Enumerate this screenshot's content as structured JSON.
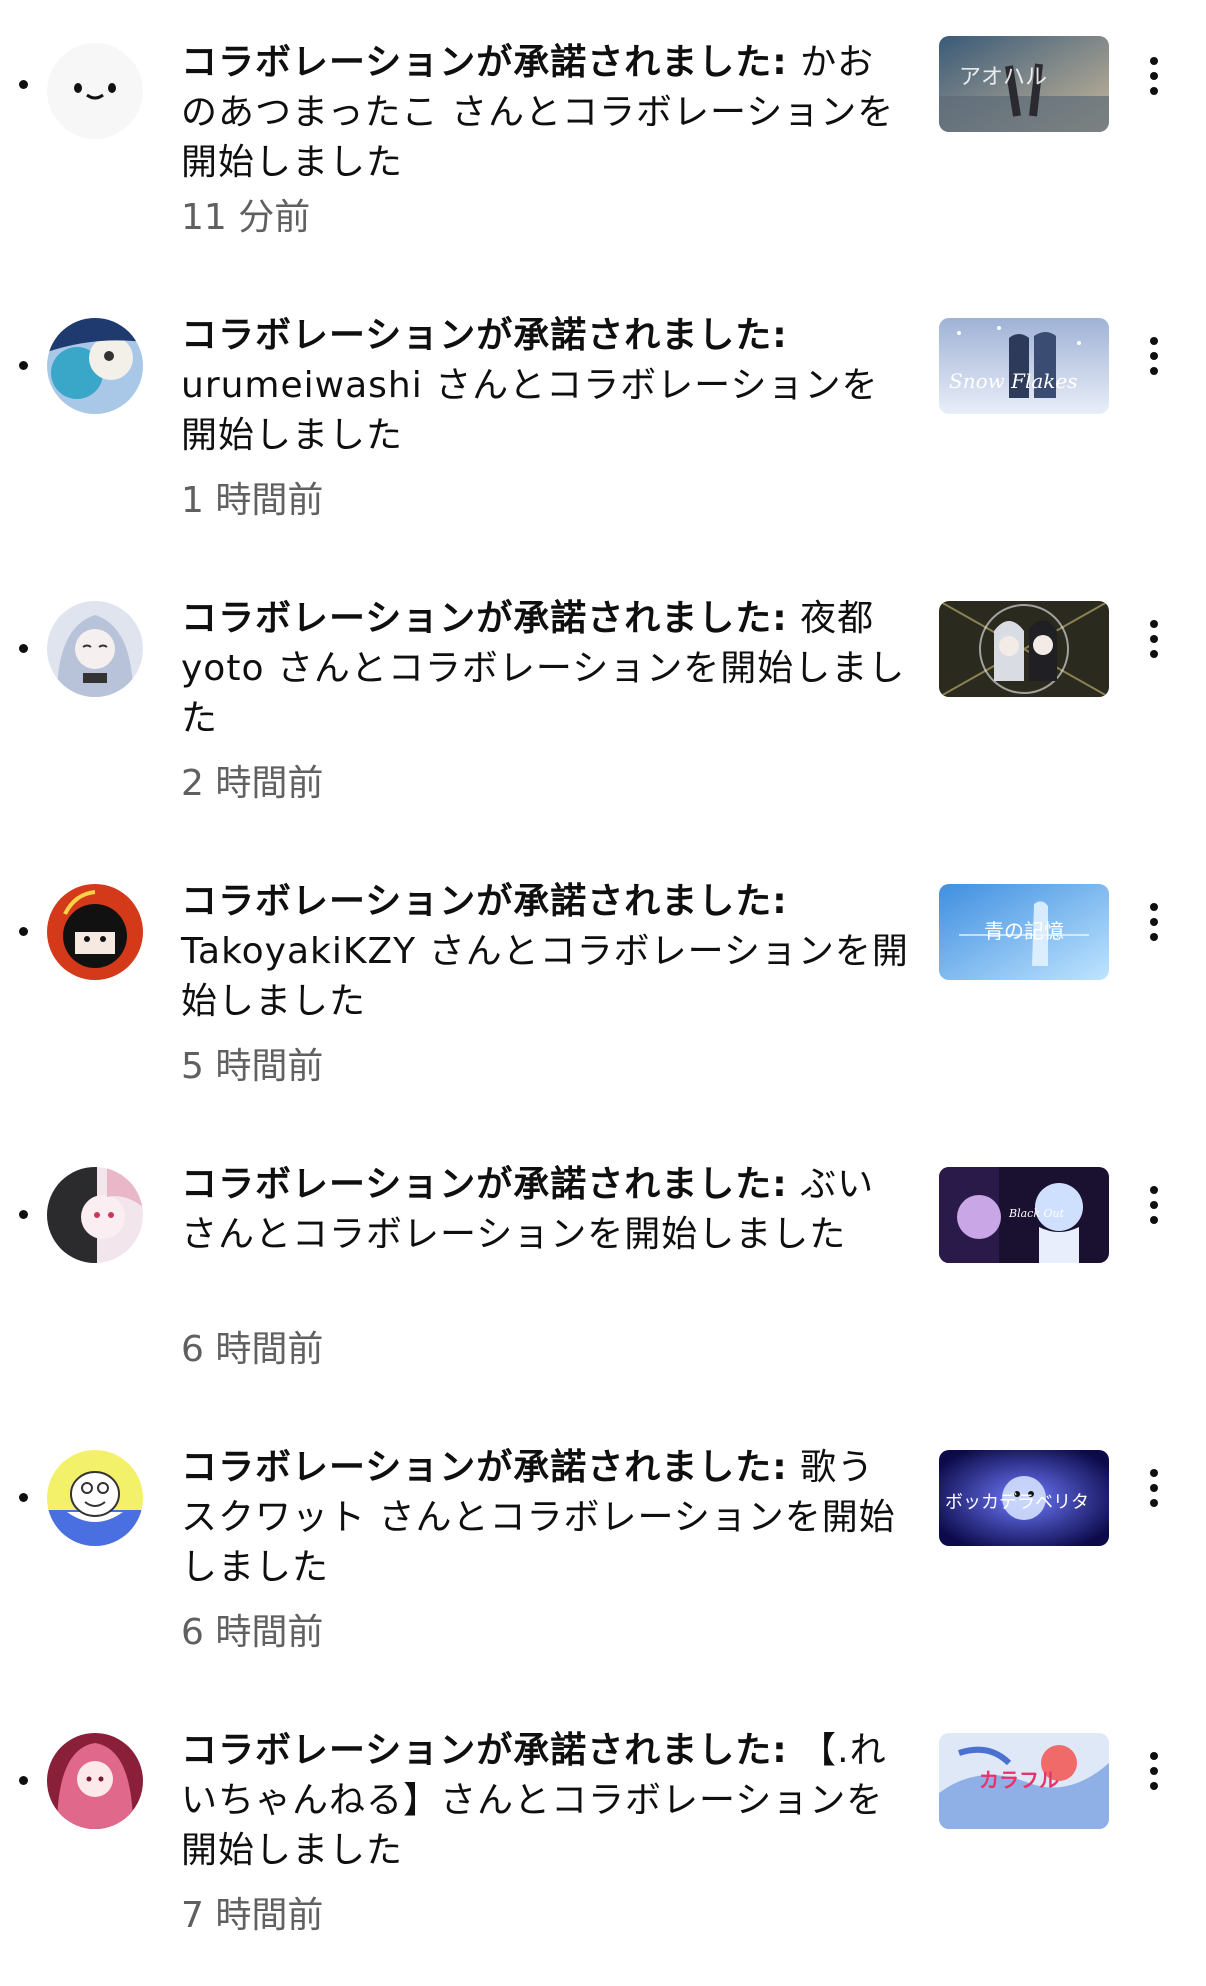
{
  "notifications": [
    {
      "title": "コラボレーションが承諾されました:",
      "message": "かおのあつまったこ さんとコラボレーションを開始しました",
      "time": "11 分前",
      "thumb_text": "アオハル"
    },
    {
      "title": "コラボレーションが承諾されました:",
      "message": "urumeiwashi さんとコラボレーションを開始しました",
      "time": "1 時間前",
      "thumb_text": "Snow Flakes"
    },
    {
      "title": "コラボレーションが承諾されました:",
      "message": "夜都yoto さんとコラボレーションを開始しました",
      "time": "2 時間前",
      "thumb_text": ""
    },
    {
      "title": "コラボレーションが承諾されました:",
      "message": "TakoyakiKZY さんとコラボレーションを開始しました",
      "time": "5 時間前",
      "thumb_text": "青の記憶"
    },
    {
      "title": "コラボレーションが承諾されました:",
      "message": "ぶい さんとコラボレーションを開始しました",
      "time": "6 時間前",
      "thumb_text": "Black Out"
    },
    {
      "title": "コラボレーションが承諾されました:",
      "message": "歌うスクワット さんとコラボレーションを開始しました",
      "time": "6 時間前",
      "thumb_text": "ボッカデラベリタ"
    },
    {
      "title": "コラボレーションが承諾されました:",
      "message": "【.れいちゃんねる】さんとコラボレーションを開始しました",
      "time": "7 時間前",
      "thumb_text": "カラフル"
    }
  ],
  "colors": {
    "text": "#0f0f0f",
    "secondary_text": "#606060",
    "background": "#ffffff"
  },
  "icons": {
    "more": "more-vert-icon",
    "unread": "unread-dot"
  }
}
